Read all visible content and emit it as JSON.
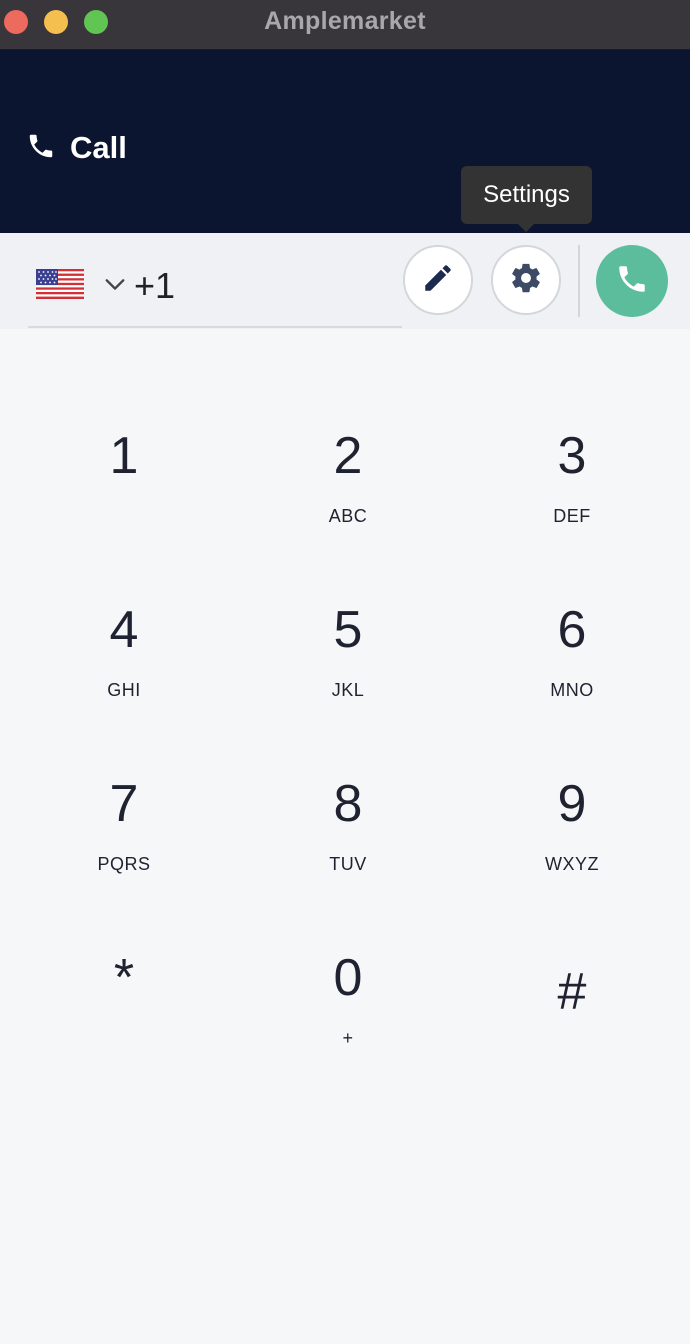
{
  "window": {
    "title": "Amplemarket"
  },
  "header": {
    "title": "Call",
    "icon": "phone-icon"
  },
  "tooltip": {
    "text": "Settings"
  },
  "dialer": {
    "country_code": "+1",
    "country_flag": "us-flag-icon",
    "edit_icon": "pencil-icon",
    "settings_icon": "gear-icon",
    "call_icon": "phone-icon",
    "accent_color": "#5cbd9d"
  },
  "keypad": [
    {
      "digit": "1",
      "letters": ""
    },
    {
      "digit": "2",
      "letters": "ABC"
    },
    {
      "digit": "3",
      "letters": "DEF"
    },
    {
      "digit": "4",
      "letters": "GHI"
    },
    {
      "digit": "5",
      "letters": "JKL"
    },
    {
      "digit": "6",
      "letters": "MNO"
    },
    {
      "digit": "7",
      "letters": "PQRS"
    },
    {
      "digit": "8",
      "letters": "TUV"
    },
    {
      "digit": "9",
      "letters": "WXYZ"
    },
    {
      "digit": "*",
      "letters": ""
    },
    {
      "digit": "0",
      "letters": "+"
    },
    {
      "digit": "#",
      "letters": ""
    }
  ]
}
